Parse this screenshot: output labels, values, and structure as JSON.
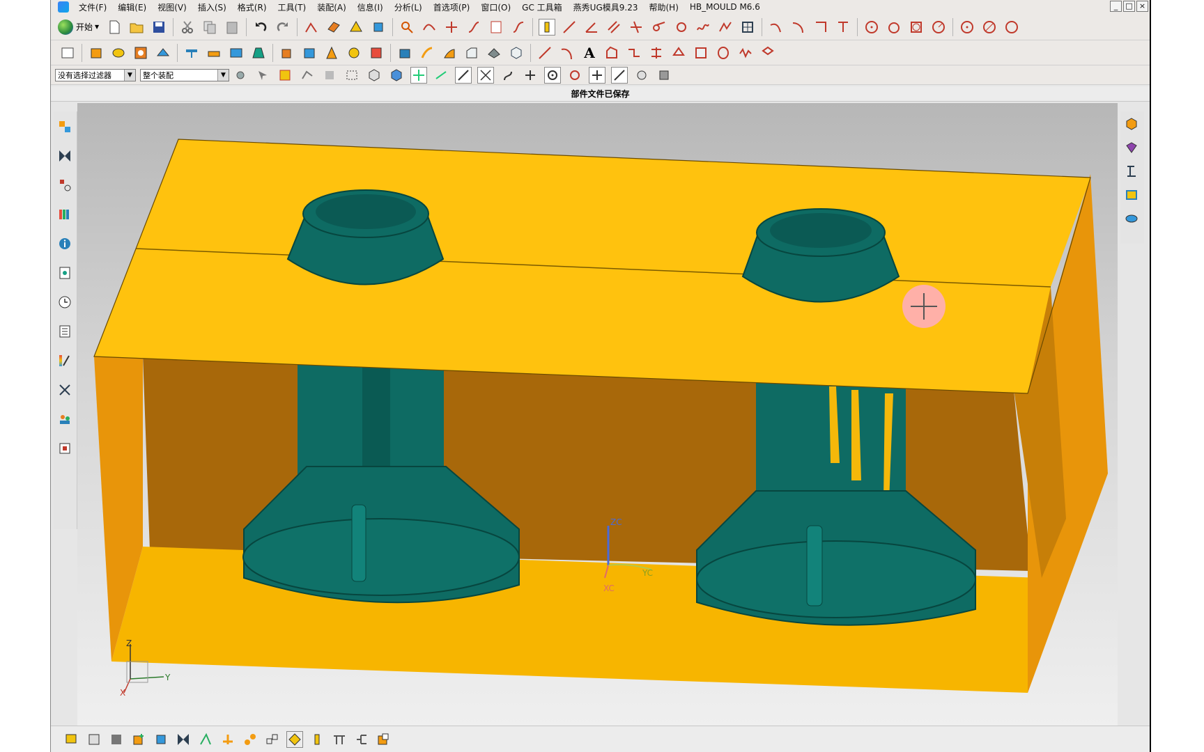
{
  "menu": {
    "items": [
      "文件(F)",
      "编辑(E)",
      "视图(V)",
      "插入(S)",
      "格式(R)",
      "工具(T)",
      "装配(A)",
      "信息(I)",
      "分析(L)",
      "首选项(P)",
      "窗口(O)",
      "GC 工具箱",
      "燕秀UG模具9.23",
      "帮助(H)",
      "HB_MOULD M6.6"
    ]
  },
  "toolbar": {
    "start_label": "开始",
    "filter_select": "没有选择过滤器",
    "assembly_select": "整个装配"
  },
  "status": {
    "message": "部件文件已保存"
  },
  "window_controls": [
    "_",
    "□",
    "×"
  ],
  "viewport": {
    "wcs_labels": {
      "z": "ZC",
      "y": "YC",
      "x": "XC"
    },
    "triad_labels": {
      "z": "Z",
      "y": "Y",
      "x": "X"
    }
  },
  "colors": {
    "block_top": "#FFC20E",
    "block_front": "#F7B500",
    "block_side": "#E8950A",
    "block_back": "#A8680A",
    "part": "#0E6B63",
    "part_dark": "#07463F"
  },
  "icons": {
    "left_sidebar": [
      "assembly-navigator-icon",
      "constraint-navigator-icon",
      "part-navigator-icon",
      "reuse-library-icon",
      "info-window-icon",
      "system-materials-icon",
      "history-icon",
      "process-navigator-icon",
      "visualization-icon",
      "manufacturing-icon",
      "roles-icon",
      "hd3d-icon"
    ],
    "right_sidebar": [
      "mold-wizard-icon",
      "mold-parting-icon",
      "ejector-icon",
      "standard-part-icon",
      "electrode-icon"
    ]
  }
}
